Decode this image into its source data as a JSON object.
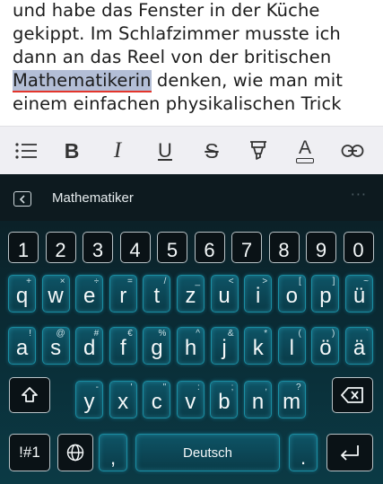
{
  "editor": {
    "text_before": "und habe das Fenster in der Küche gekippt. Im Schlafzimmer musste ich dann an das Reel von der britischen ",
    "highlighted_word": "Mathematikerin",
    "text_after": " denken, wie man mit einem einfachen physikalischen Trick"
  },
  "toolbar": {
    "bold_label": "B",
    "italic_label": "I",
    "underline_label": "U",
    "strike_label": "S",
    "font_color_label": "A"
  },
  "keyboard": {
    "suggestion": "Mathematiker",
    "more_label": "···",
    "number_row": [
      "1",
      "2",
      "3",
      "4",
      "5",
      "6",
      "7",
      "8",
      "9",
      "0"
    ],
    "row1": [
      {
        "key": "q",
        "alt": "+"
      },
      {
        "key": "w",
        "alt": "×"
      },
      {
        "key": "e",
        "alt": "÷"
      },
      {
        "key": "r",
        "alt": "="
      },
      {
        "key": "t",
        "alt": "/"
      },
      {
        "key": "z",
        "alt": "_"
      },
      {
        "key": "u",
        "alt": "<"
      },
      {
        "key": "i",
        "alt": ">"
      },
      {
        "key": "o",
        "alt": "["
      },
      {
        "key": "p",
        "alt": "]"
      },
      {
        "key": "ü",
        "alt": "~"
      }
    ],
    "row2": [
      {
        "key": "a",
        "alt": "!"
      },
      {
        "key": "s",
        "alt": "@"
      },
      {
        "key": "d",
        "alt": "#"
      },
      {
        "key": "f",
        "alt": "€"
      },
      {
        "key": "g",
        "alt": "%"
      },
      {
        "key": "h",
        "alt": "^"
      },
      {
        "key": "j",
        "alt": "&"
      },
      {
        "key": "k",
        "alt": "*"
      },
      {
        "key": "l",
        "alt": "("
      },
      {
        "key": "ö",
        "alt": ")"
      },
      {
        "key": "ä",
        "alt": "`"
      }
    ],
    "row3": [
      {
        "key": "y",
        "alt": "-"
      },
      {
        "key": "x",
        "alt": "'"
      },
      {
        "key": "c",
        "alt": "\""
      },
      {
        "key": "v",
        "alt": ":"
      },
      {
        "key": "b",
        "alt": ";"
      },
      {
        "key": "n",
        "alt": ","
      },
      {
        "key": "m",
        "alt": "?"
      }
    ],
    "symbols_label": "!#1",
    "comma_label": ",",
    "space_label": "Deutsch",
    "period_label": "."
  },
  "colors": {
    "highlight": "#b3bed6",
    "spell_underline": "#e3352c",
    "key_glow": "#1a8ea3",
    "toolbar_bg": "#efeff3"
  }
}
